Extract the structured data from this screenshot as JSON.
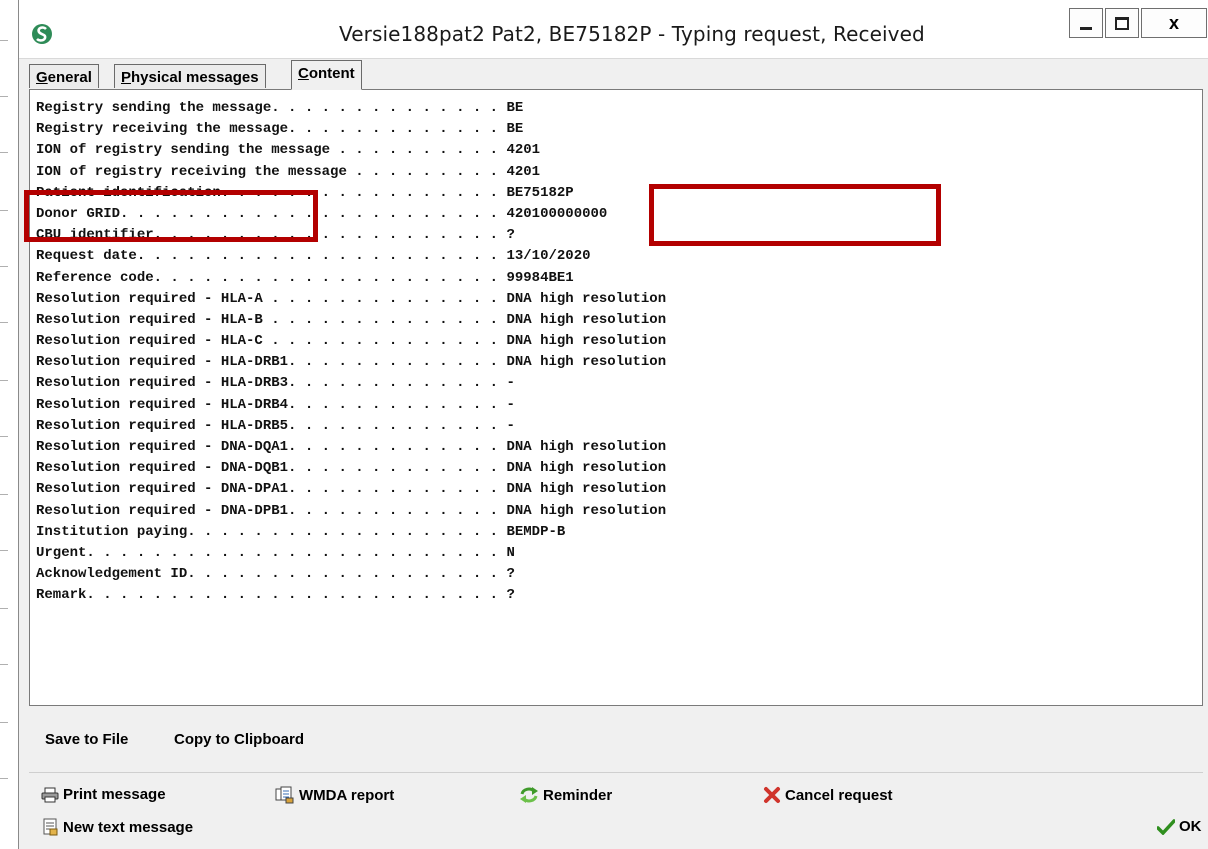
{
  "window": {
    "title": "Versie188pat2 Pat2, BE75182P - Typing request, Received",
    "close_label": "x"
  },
  "tabs": [
    {
      "label_u": "G",
      "label_rest": "eneral"
    },
    {
      "label_u": "P",
      "label_rest": "hysical messages"
    },
    {
      "label_u": "C",
      "label_rest": "ontent"
    }
  ],
  "message_rows": [
    "Registry sending the message. . . . . . . . . . . . . . BE",
    "Registry receiving the message. . . . . . . . . . . . . BE",
    "ION of registry sending the message . . . . . . . . . . 4201",
    "ION of registry receiving the message . . . . . . . . . 4201",
    "Patient identification. . . . . . . . . . . . . . . . . BE75182P",
    "Donor GRID. . . . . . . . . . . . . . . . . . . . . . . 420100000000",
    "CBU identifier. . . . . . . . . . . . . . . . . . . . . ?",
    "Request date. . . . . . . . . . . . . . . . . . . . . . 13/10/2020",
    "Reference code. . . . . . . . . . . . . . . . . . . . . 99984BE1",
    "Resolution required - HLA-A . . . . . . . . . . . . . . DNA high resolution",
    "Resolution required - HLA-B . . . . . . . . . . . . . . DNA high resolution",
    "Resolution required - HLA-C . . . . . . . . . . . . . . DNA high resolution",
    "Resolution required - HLA-DRB1. . . . . . . . . . . . . DNA high resolution",
    "Resolution required - HLA-DRB3. . . . . . . . . . . . . -",
    "Resolution required - HLA-DRB4. . . . . . . . . . . . . -",
    "Resolution required - HLA-DRB5. . . . . . . . . . . . . -",
    "Resolution required - DNA-DQA1. . . . . . . . . . . . . DNA high resolution",
    "Resolution required - DNA-DQB1. . . . . . . . . . . . . DNA high resolution",
    "Resolution required - DNA-DPA1. . . . . . . . . . . . . DNA high resolution",
    "Resolution required - DNA-DPB1. . . . . . . . . . . . . DNA high resolution",
    "Institution paying. . . . . . . . . . . . . . . . . . . BEMDP-B",
    "Urgent. . . . . . . . . . . . . . . . . . . . . . . . . N",
    "Acknowledgement ID. . . . . . . . . . . . . . . . . . . ?",
    "Remark. . . . . . . . . . . . . . . . . . . . . . . . . ?"
  ],
  "highlight_color": "#b30000",
  "file_actions": {
    "save": "Save to File",
    "copy": "Copy to Clipboard"
  },
  "actions": {
    "print": "Print message",
    "wmda": "WMDA report",
    "reminder": "Reminder",
    "cancel": "Cancel request",
    "new_text": "New text message",
    "ok": "OK"
  }
}
